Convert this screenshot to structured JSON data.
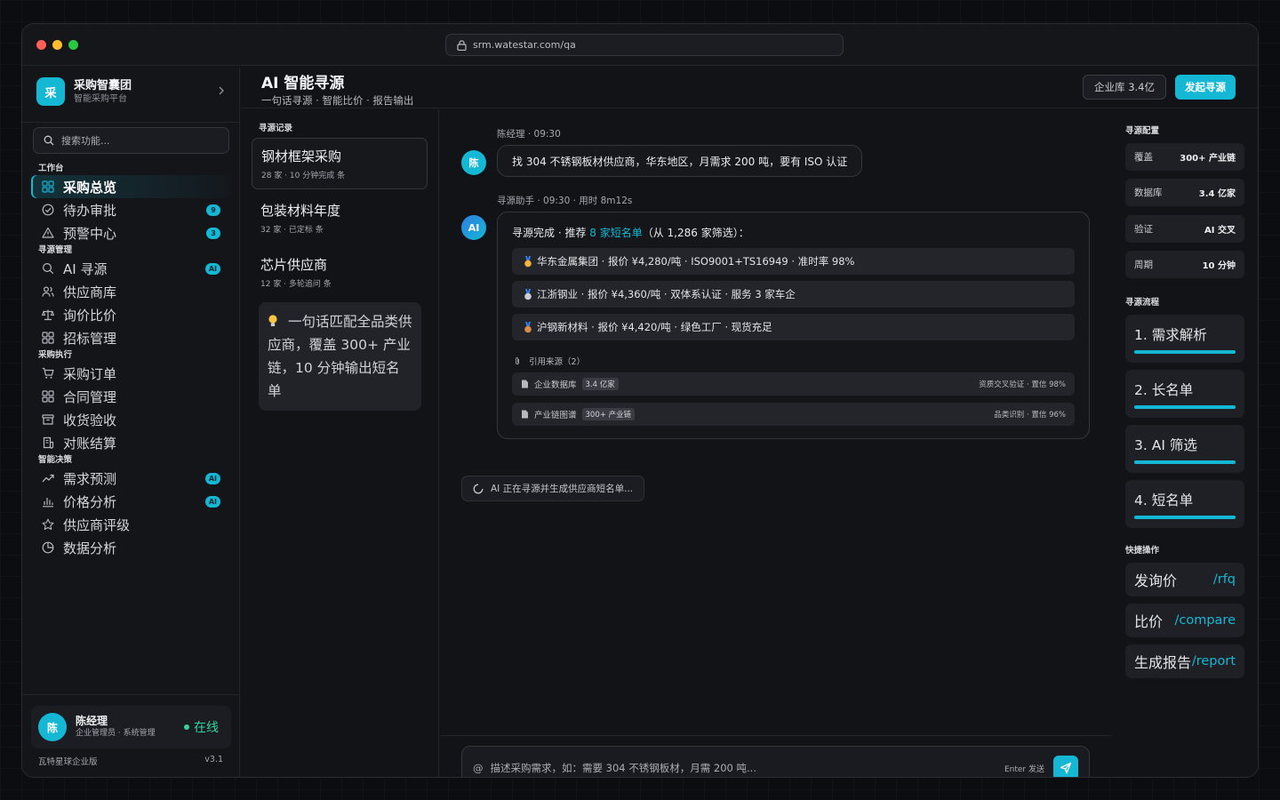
{
  "browser": {
    "url": "srm.watestar.com/qa"
  },
  "brand": {
    "logo": "采",
    "title": "采购智囊团",
    "subtitle": "智能采购平台"
  },
  "search": {
    "placeholder": "搜索功能..."
  },
  "nav": [
    {
      "group": "工作台",
      "items": [
        {
          "label": "采购总览",
          "icon": "grid-icon",
          "active": true,
          "badge": ""
        },
        {
          "label": "待办审批",
          "icon": "check-circle-icon",
          "badge": "9"
        },
        {
          "label": "预警中心",
          "icon": "alert-triangle-icon",
          "badge": "3"
        }
      ]
    },
    {
      "group": "寻源管理",
      "items": [
        {
          "label": "AI 寻源",
          "icon": "search-icon",
          "badge": "AI"
        },
        {
          "label": "供应商库",
          "icon": "users-icon",
          "badge": ""
        },
        {
          "label": "询价比价",
          "icon": "scale-icon",
          "badge": ""
        },
        {
          "label": "招标管理",
          "icon": "grid-icon",
          "badge": ""
        }
      ]
    },
    {
      "group": "采购执行",
      "items": [
        {
          "label": "采购订单",
          "icon": "cart-icon",
          "badge": ""
        },
        {
          "label": "合同管理",
          "icon": "grid-icon",
          "badge": ""
        },
        {
          "label": "收货验收",
          "icon": "archive-icon",
          "badge": ""
        },
        {
          "label": "对账结算",
          "icon": "receipt-icon",
          "badge": ""
        }
      ]
    },
    {
      "group": "智能决策",
      "items": [
        {
          "label": "需求预测",
          "icon": "trend-icon",
          "badge": "AI"
        },
        {
          "label": "价格分析",
          "icon": "bar-chart-icon",
          "badge": "AI"
        },
        {
          "label": "供应商评级",
          "icon": "star-icon",
          "badge": ""
        },
        {
          "label": "数据分析",
          "icon": "pie-icon",
          "badge": ""
        }
      ]
    }
  ],
  "user": {
    "avatar": "陈",
    "name": "陈经理",
    "role": "企业管理员 · 系统管理",
    "status": "在线"
  },
  "footer": {
    "edition": "瓦特星球企业版",
    "version": "v3.1"
  },
  "header": {
    "title": "AI 智能寻源",
    "subtitle": "一句话寻源 · 智能比价 · 报告输出",
    "db_button": "企业库 3.4亿",
    "primary_button": "发起寻源"
  },
  "history": {
    "heading": "寻源记录",
    "items": [
      {
        "title": "钢材框架采购",
        "meta": "28 家 · 10 分钟完成 条"
      },
      {
        "title": "包装材料年度",
        "meta": "32 家 · 已定标 条"
      },
      {
        "title": "芯片供应商",
        "meta": "12 家 · 多轮追问 条"
      }
    ],
    "tip": "一句话匹配全品类供应商，覆盖 300+ 产业链，10 分钟输出短名单"
  },
  "chat": {
    "user_msg": {
      "avatar": "陈",
      "meta": "陈经理 · 09:30",
      "text": "找 304 不锈钢板材供应商，华东地区，月需求 200 吨，要有 ISO 认证"
    },
    "ai_msg": {
      "avatar": "AI",
      "meta": "寻源助手 · 09:30 · 用时 8m12s",
      "head_prefix": "寻源完成 · 推荐 ",
      "head_highlight": "8 家短名单",
      "head_suffix": "（从 1,286 家筛选）：",
      "recommendations": [
        {
          "medal": "gold",
          "text": "华东金属集团 · 报价 ¥4,280/吨 · ISO9001+TS16949 · 准时率 98%"
        },
        {
          "medal": "silver",
          "text": "江浙钢业 · 报价 ¥4,360/吨 · 双体系认证 · 服务 3 家车企"
        },
        {
          "medal": "bronze",
          "text": "沪钢新材料 · 报价 ¥4,420/吨 · 绿色工厂 · 现货充足"
        }
      ],
      "citations_label": "引用来源（2）",
      "sources": [
        {
          "name": "企业数据库",
          "tag": "3.4 亿家",
          "right": "资质交叉验证 · 置信 98%"
        },
        {
          "name": "产业链图谱",
          "tag": "300+ 产业链",
          "right": "品类识别 · 置信 96%"
        }
      ]
    },
    "status": "AI 正在寻源并生成供应商短名单...",
    "composer": {
      "placeholder": "描述采购需求，如：需要 304 不锈钢板材，月需 200 吨...",
      "hint": "Enter 发送"
    }
  },
  "config": {
    "heading": "寻源配置",
    "items": [
      {
        "label": "覆盖",
        "value": "300+ 产业链"
      },
      {
        "label": "数据库",
        "value": "3.4 亿家"
      },
      {
        "label": "验证",
        "value": "AI 交叉"
      },
      {
        "label": "周期",
        "value": "10 分钟"
      }
    ]
  },
  "flow": {
    "heading": "寻源流程",
    "steps": [
      {
        "label": "1. 需求解析",
        "progress": 1.0
      },
      {
        "label": "2. 长名单",
        "progress": 1.0
      },
      {
        "label": "3. AI 筛选",
        "progress": 1.0
      },
      {
        "label": "4. 短名单",
        "progress": 1.0
      }
    ]
  },
  "quick": {
    "heading": "快捷操作",
    "items": [
      {
        "label": "发询价",
        "cmd": "/rfq"
      },
      {
        "label": "比价",
        "cmd": "/compare"
      },
      {
        "label": "生成报告",
        "cmd": "/report"
      }
    ]
  },
  "colors": {
    "accent": "#14b8d4",
    "online": "#34d399",
    "ai_avatar": "#2f7de1"
  }
}
